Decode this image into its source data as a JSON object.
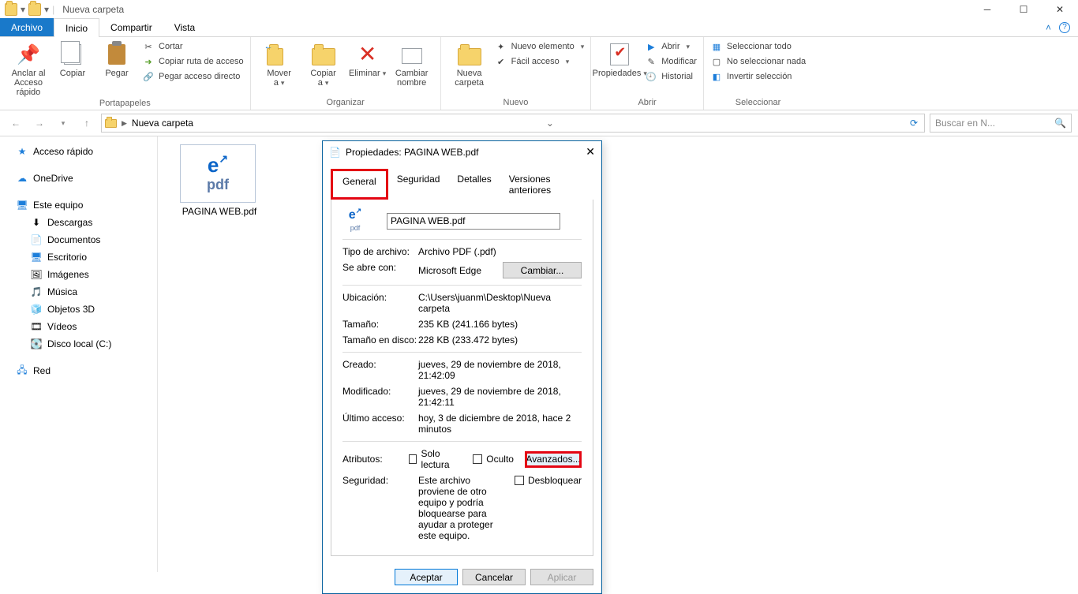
{
  "window": {
    "title": "Nueva carpeta",
    "minimize": "Minimize",
    "maximize": "Restore",
    "close": "Close"
  },
  "tabs": {
    "file": "Archivo",
    "home": "Inicio",
    "share": "Compartir",
    "view": "Vista"
  },
  "ribbon": {
    "clipboard": {
      "pin": "Anclar al\nAcceso rápido",
      "copy": "Copiar",
      "paste": "Pegar",
      "cut": "Cortar",
      "copypath": "Copiar ruta de acceso",
      "pasteshortcut": "Pegar acceso directo",
      "group_label": "Portapapeles"
    },
    "organize": {
      "moveto": "Mover\na",
      "copyto": "Copiar\na",
      "delete": "Eliminar",
      "rename": "Cambiar\nnombre",
      "group_label": "Organizar"
    },
    "newg": {
      "newfolder": "Nueva\ncarpeta",
      "newitem": "Nuevo elemento",
      "easyaccess": "Fácil acceso",
      "group_label": "Nuevo"
    },
    "openg": {
      "properties": "Propiedades",
      "open": "Abrir",
      "edit": "Modificar",
      "history": "Historial",
      "group_label": "Abrir"
    },
    "selectg": {
      "selectall": "Seleccionar todo",
      "selectnone": "No seleccionar nada",
      "invert": "Invertir selección",
      "group_label": "Seleccionar"
    }
  },
  "address": {
    "crumb1": "Nueva carpeta",
    "search_placeholder": "Buscar en N..."
  },
  "sidebar": {
    "quick": "Acceso rápido",
    "onedrive": "OneDrive",
    "thispc": "Este equipo",
    "downloads": "Descargas",
    "documents": "Documentos",
    "desktop": "Escritorio",
    "pictures": "Imágenes",
    "music": "Música",
    "objects3d": "Objetos 3D",
    "videos": "Vídeos",
    "localdisk": "Disco local (C:)",
    "network": "Red"
  },
  "file": {
    "name": "PAGINA WEB.pdf"
  },
  "dialog": {
    "title": "Propiedades: PAGINA WEB.pdf",
    "tabs": {
      "general": "General",
      "security": "Seguridad",
      "details": "Detalles",
      "previous": "Versiones anteriores"
    },
    "filename": "PAGINA WEB.pdf",
    "type_label": "Tipo de archivo:",
    "type_value": "Archivo PDF (.pdf)",
    "opens_label": "Se abre con:",
    "opens_value": "Microsoft Edge",
    "change_btn": "Cambiar...",
    "location_label": "Ubicación:",
    "location_value": "C:\\Users\\juanm\\Desktop\\Nueva carpeta",
    "size_label": "Tamaño:",
    "size_value": "235 KB (241.166 bytes)",
    "sizedisk_label": "Tamaño en disco:",
    "sizedisk_value": "228 KB (233.472 bytes)",
    "created_label": "Creado:",
    "created_value": "jueves, 29 de noviembre de 2018, 21:42:09",
    "modified_label": "Modificado:",
    "modified_value": "jueves, 29 de noviembre de 2018, 21:42:11",
    "accessed_label": "Último acceso:",
    "accessed_value": "hoy, 3 de diciembre de 2018, hace 2 minutos",
    "attributes_label": "Atributos:",
    "readonly": "Solo lectura",
    "hidden": "Oculto",
    "advanced": "Avanzados...",
    "security_label": "Seguridad:",
    "security_text": "Este archivo proviene de otro equipo y podría bloquearse para ayudar a proteger este equipo.",
    "unblock": "Desbloquear",
    "ok": "Aceptar",
    "cancel": "Cancelar",
    "apply": "Aplicar"
  }
}
